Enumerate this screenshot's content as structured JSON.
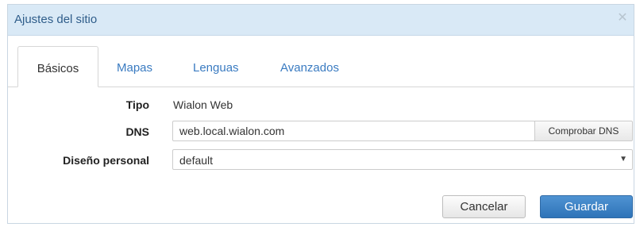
{
  "dialog": {
    "title": "Ajustes del sitio",
    "close_icon": "close-icon"
  },
  "tabs": [
    {
      "label": "Básicos",
      "active": true
    },
    {
      "label": "Mapas",
      "active": false
    },
    {
      "label": "Lenguas",
      "active": false
    },
    {
      "label": "Avanzados",
      "active": false
    }
  ],
  "form": {
    "tipo": {
      "label": "Tipo",
      "value": "Wialon Web"
    },
    "dns": {
      "label": "DNS",
      "value": "web.local.wialon.com",
      "button": "Comprobar DNS"
    },
    "design": {
      "label": "Diseño personal",
      "selected": "default",
      "arrow_icon": "dropdown-arrow-icon"
    }
  },
  "buttons": {
    "cancel": "Cancelar",
    "save": "Guardar"
  },
  "colors": {
    "titlebar_bg": "#d9e9f6",
    "title_text": "#2f5d8a",
    "tab_link": "#3a7bc1",
    "primary_button": "#3a80c4"
  }
}
